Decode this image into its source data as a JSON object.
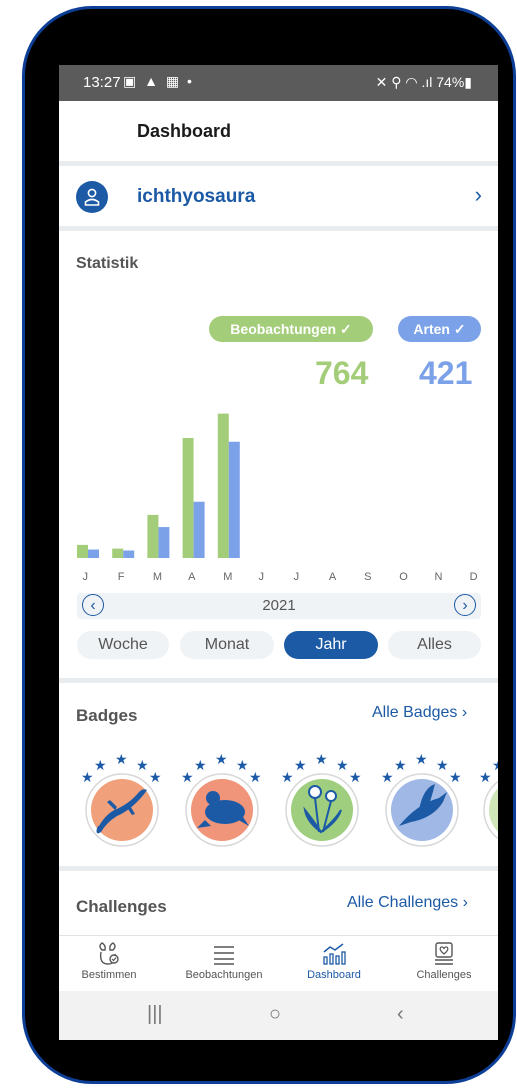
{
  "status": {
    "time": "13:27",
    "left_icons": "▣ ▲ ▦ •",
    "right": "✕ ⚲ ◠ .ıl 74%▮"
  },
  "appbar": {
    "title": "Dashboard"
  },
  "user": {
    "name": "ichthyosaura"
  },
  "stats": {
    "title": "Statistik",
    "observations_label": "Beobachtungen ✓",
    "species_label": "Arten ✓",
    "observations_count": "764",
    "species_count": "421",
    "year": "2021",
    "periods": [
      "Woche",
      "Monat",
      "Jahr",
      "Alles"
    ],
    "active_period": "Jahr"
  },
  "chart_data": {
    "type": "bar",
    "categories": [
      "J",
      "F",
      "M",
      "A",
      "M",
      "J",
      "J",
      "A",
      "S",
      "O",
      "N",
      "D"
    ],
    "series": [
      {
        "name": "Beobachtungen",
        "values": [
          14,
          10,
          46,
          128,
          154,
          0,
          0,
          0,
          0,
          0,
          0,
          0
        ]
      },
      {
        "name": "Arten",
        "values": [
          9,
          8,
          33,
          60,
          124,
          0,
          0,
          0,
          0,
          0,
          0,
          0
        ]
      }
    ],
    "colors": {
      "Beobachtungen": "#a4cd7a",
      "Arten": "#7ba1e8"
    },
    "ylim": [
      0,
      160
    ]
  },
  "badges": {
    "title": "Badges",
    "link": "Alle Badges ›",
    "items": [
      {
        "icon": "lizard-icon",
        "bg": "#f0a07a"
      },
      {
        "icon": "frog-icon",
        "bg": "#f0957a"
      },
      {
        "icon": "dandelion-icon",
        "bg": "#9fcf7e"
      },
      {
        "icon": "bird-icon",
        "bg": "#9fb8e6"
      }
    ]
  },
  "challenges": {
    "title": "Challenges",
    "link": "Alle Challenges ›"
  },
  "nav": {
    "items": [
      "Bestimmen",
      "Beobachtungen",
      "Dashboard",
      "Challenges"
    ],
    "active": "Dashboard"
  },
  "sysnav": {
    "recents": "|||",
    "home": "○",
    "back": "‹"
  },
  "colors": {
    "primary": "#1c5aa6",
    "green": "#a4cd7a",
    "blue": "#7ba1e8"
  }
}
